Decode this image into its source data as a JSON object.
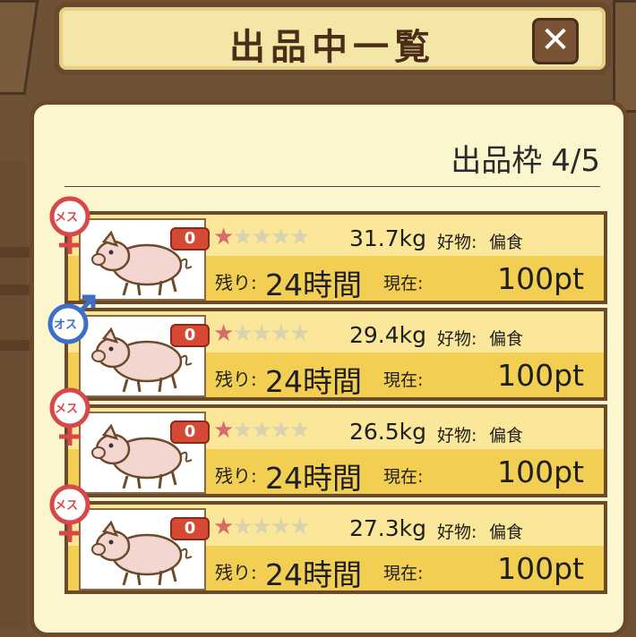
{
  "header": {
    "title": "出品中一覧",
    "close_icon": "close-x-icon"
  },
  "summary": {
    "slots_label": "出品枠",
    "slots_value": "4/5"
  },
  "listings": [
    {
      "gender": "メス",
      "gender_icon": "female-icon",
      "badge": "0",
      "stars": 1,
      "stars_max": 5,
      "weight": "31.7kg",
      "fav_label": "好物:",
      "fav_value": "偏食",
      "remain_label": "残り:",
      "remain_value": "24時間",
      "current_label": "現在:",
      "points": "100pt"
    },
    {
      "gender": "オス",
      "gender_icon": "male-icon",
      "badge": "0",
      "stars": 1,
      "stars_max": 5,
      "weight": "29.4kg",
      "fav_label": "好物:",
      "fav_value": "偏食",
      "remain_label": "残り:",
      "remain_value": "24時間",
      "current_label": "現在:",
      "points": "100pt"
    },
    {
      "gender": "メス",
      "gender_icon": "female-icon",
      "badge": "0",
      "stars": 1,
      "stars_max": 5,
      "weight": "26.5kg",
      "fav_label": "好物:",
      "fav_value": "偏食",
      "remain_label": "残り:",
      "remain_value": "24時間",
      "current_label": "現在:",
      "points": "100pt"
    },
    {
      "gender": "メス",
      "gender_icon": "female-icon",
      "badge": "0",
      "stars": 1,
      "stars_max": 5,
      "weight": "27.3kg",
      "fav_label": "好物:",
      "fav_value": "偏食",
      "remain_label": "残り:",
      "remain_value": "24時間",
      "current_label": "現在:",
      "points": "100pt"
    }
  ],
  "colors": {
    "female": "#d94848",
    "male": "#3b6fc9",
    "row_top": "#fbe79a",
    "row_bottom": "#f2cf52",
    "star_on": "#d86a6a",
    "star_off": "#d9d2ae"
  }
}
